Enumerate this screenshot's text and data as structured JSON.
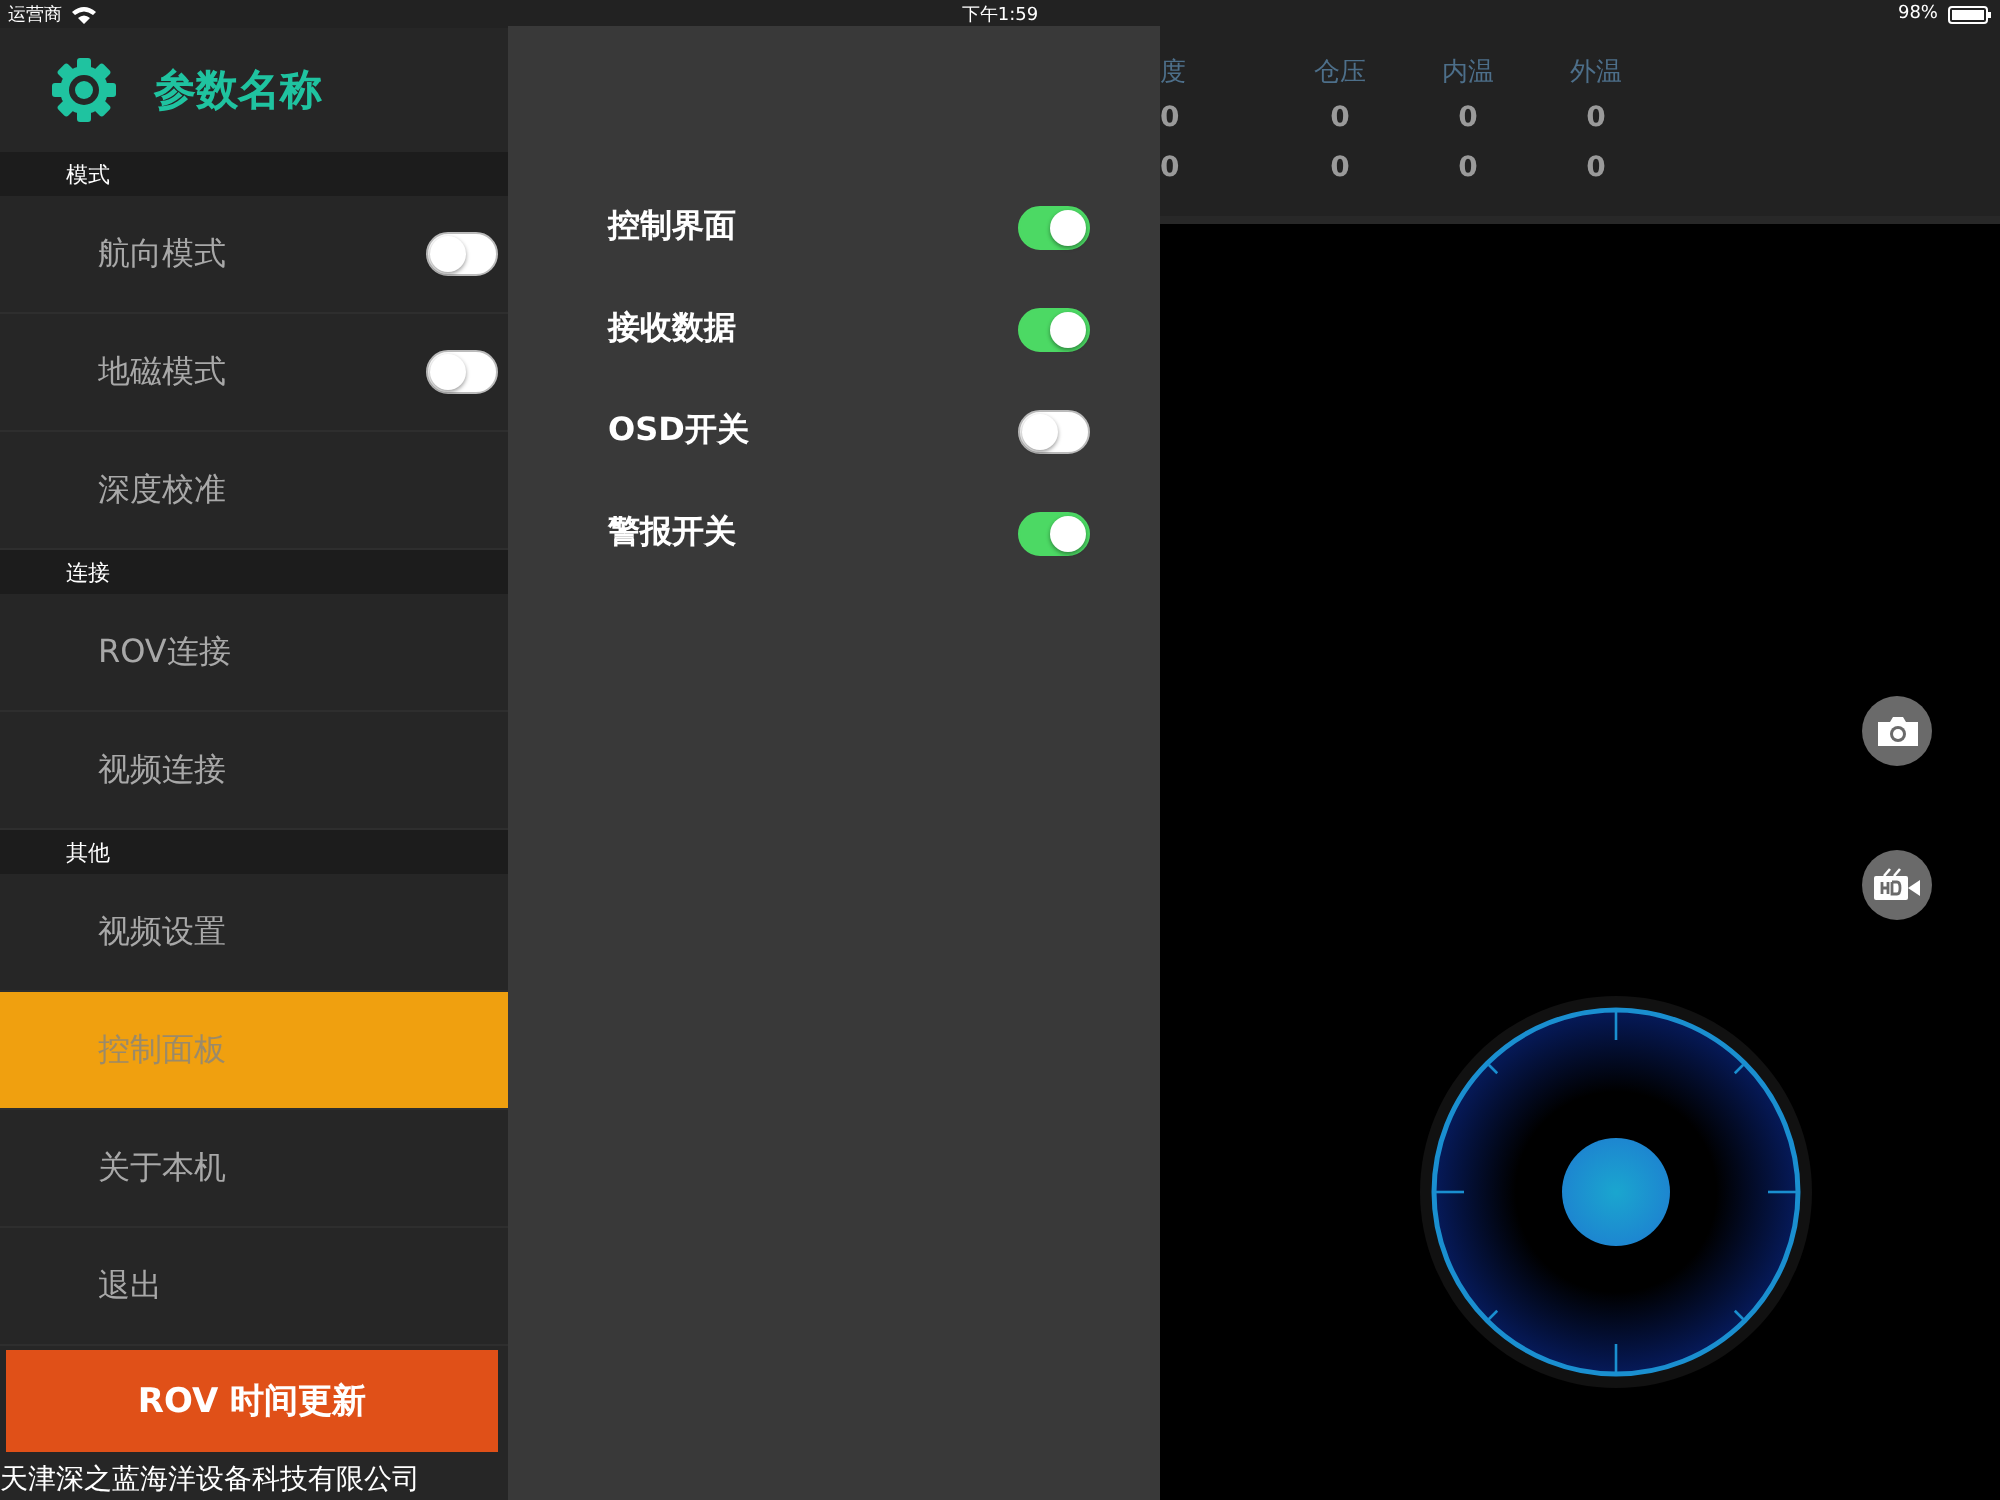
{
  "status_bar": {
    "carrier": "运营商",
    "time": "下午1:59",
    "battery": "98%"
  },
  "sidebar": {
    "title": "参数名称",
    "sections": [
      {
        "header": "模式",
        "items": [
          {
            "label": "航向模式",
            "kind": "toggle",
            "on": false,
            "selected": false
          },
          {
            "label": "地磁模式",
            "kind": "toggle",
            "on": false,
            "selected": false
          },
          {
            "label": "深度校准",
            "kind": "link",
            "selected": false
          }
        ]
      },
      {
        "header": "连接",
        "items": [
          {
            "label": "ROV连接",
            "kind": "link",
            "selected": false
          },
          {
            "label": "视频连接",
            "kind": "link",
            "selected": false
          }
        ]
      },
      {
        "header": "其他",
        "items": [
          {
            "label": "视频设置",
            "kind": "link",
            "selected": false
          },
          {
            "label": "控制面板",
            "kind": "link",
            "selected": true
          },
          {
            "label": "关于本机",
            "kind": "link",
            "selected": false
          },
          {
            "label": "退出",
            "kind": "link",
            "selected": false
          }
        ]
      }
    ],
    "button": "ROV 时间更新",
    "footer": "天津深之蓝海洋设备科技有限公司"
  },
  "panel": {
    "switches": [
      {
        "label": "控制界面",
        "on": true
      },
      {
        "label": "接收数据",
        "on": true
      },
      {
        "label": "OSD开关",
        "on": false
      },
      {
        "label": "警报开关",
        "on": true
      }
    ]
  },
  "telemetry": {
    "columns": [
      {
        "header": "度",
        "values": [
          "0",
          "0"
        ]
      },
      {
        "header": "仓压",
        "values": [
          "0",
          "0"
        ]
      },
      {
        "header": "内温",
        "values": [
          "0",
          "0"
        ]
      },
      {
        "header": "外温",
        "values": [
          "0",
          "0"
        ]
      }
    ]
  }
}
